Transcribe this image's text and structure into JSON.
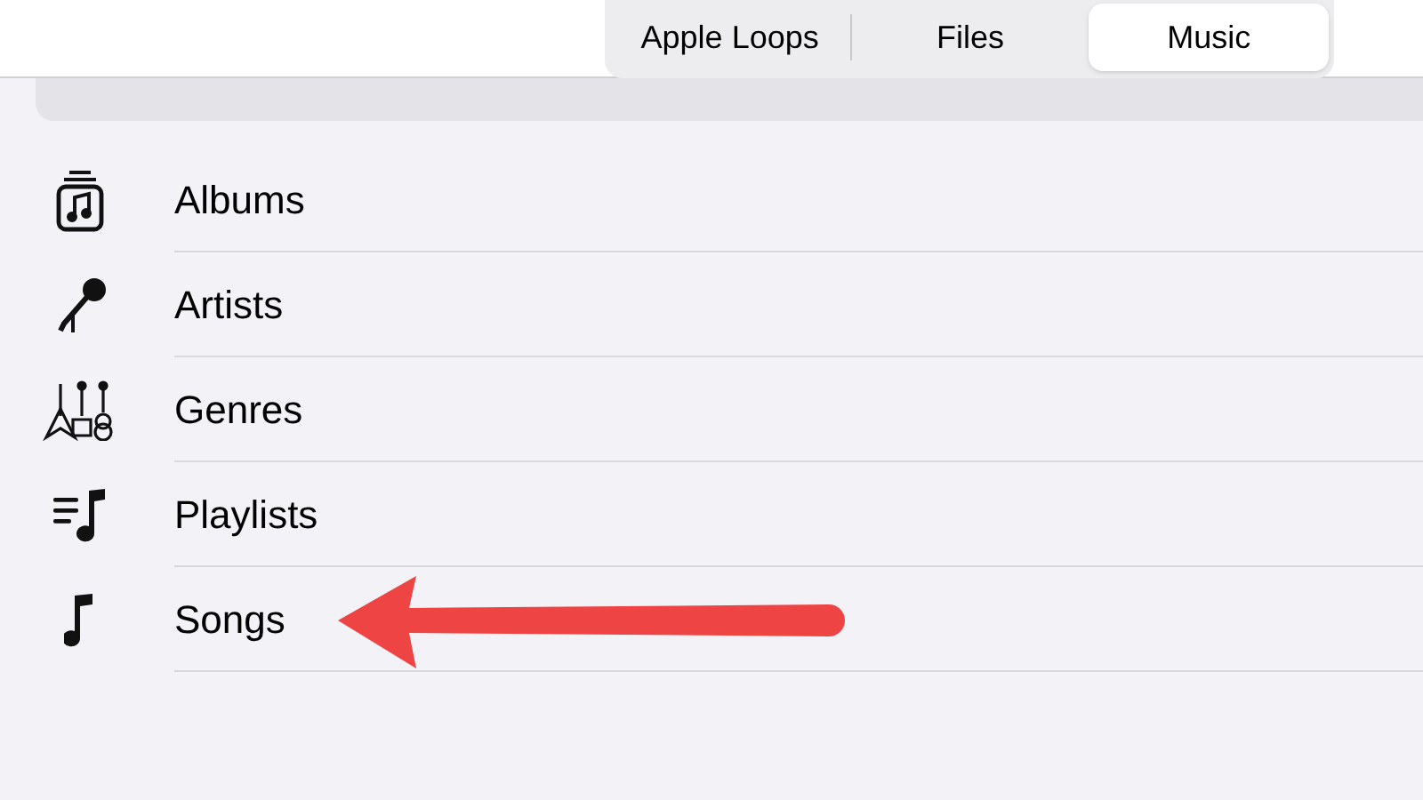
{
  "tabs": [
    {
      "label": "Apple Loops",
      "selected": false
    },
    {
      "label": "Files",
      "selected": false
    },
    {
      "label": "Music",
      "selected": true
    }
  ],
  "categories": [
    {
      "label": "Albums",
      "kind": "albums"
    },
    {
      "label": "Artists",
      "kind": "artists"
    },
    {
      "label": "Genres",
      "kind": "genres"
    },
    {
      "label": "Playlists",
      "kind": "playlists"
    },
    {
      "label": "Songs",
      "kind": "songs"
    }
  ]
}
